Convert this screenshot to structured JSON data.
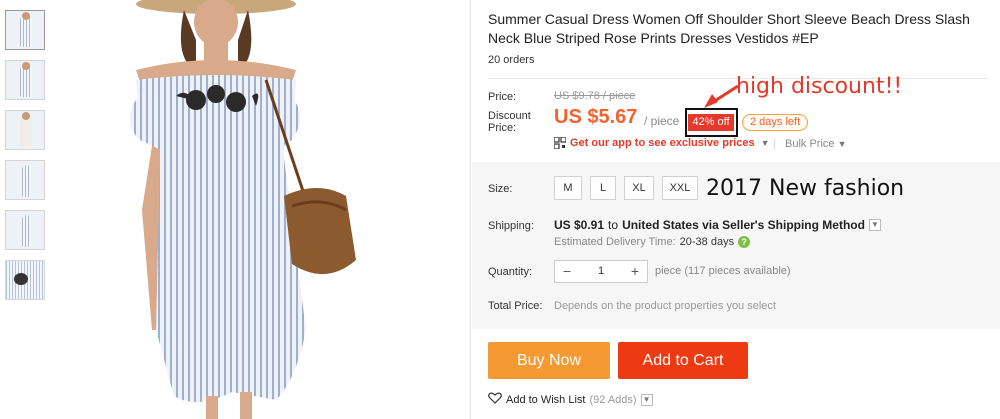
{
  "gallery": {
    "thumbnail_count": 6,
    "active_index": 0
  },
  "product": {
    "title": "Summer Casual Dress Women Off Shoulder Short Sleeve Beach Dress Slash Neck Blue Striped Rose Prints Dresses Vestidos #EP",
    "orders": "20 orders"
  },
  "pricing": {
    "price_label": "Price:",
    "original_price": "US $9.78 / piece",
    "discount_label_line1": "Discount",
    "discount_label_line2": "Price:",
    "sale_price": "US $5.67",
    "per_piece": "/ piece",
    "discount_badge": "42% off",
    "days_left": "2 days left",
    "app_link": "Get our app to see exclusive prices",
    "bulk_price": "Bulk Price",
    "accent_color": "#f5622c",
    "badge_color": "#e4392b"
  },
  "annotations": {
    "high_discount": "high discount!!",
    "new_fashion": "2017 New fashion"
  },
  "options": {
    "size_label": "Size:",
    "sizes": [
      "M",
      "L",
      "XL",
      "XXL"
    ],
    "shipping_label": "Shipping:",
    "shipping_cost": "US $0.91",
    "shipping_to": "to",
    "shipping_dest": "United States via Seller's Shipping Method",
    "delivery_label": "Estimated Delivery Time:",
    "delivery_days": "20-38 days",
    "quantity_label": "Quantity:",
    "quantity_value": "1",
    "quantity_note": "piece (117 pieces available)",
    "total_label": "Total Price:",
    "total_note": "Depends on the product properties you select"
  },
  "actions": {
    "buy_now": "Buy Now",
    "add_to_cart": "Add to Cart",
    "buy_now_color": "#f59a32",
    "add_to_cart_color": "#ee3a12",
    "wishlist": "Add to Wish List",
    "wishlist_count": "(92 Adds)"
  }
}
